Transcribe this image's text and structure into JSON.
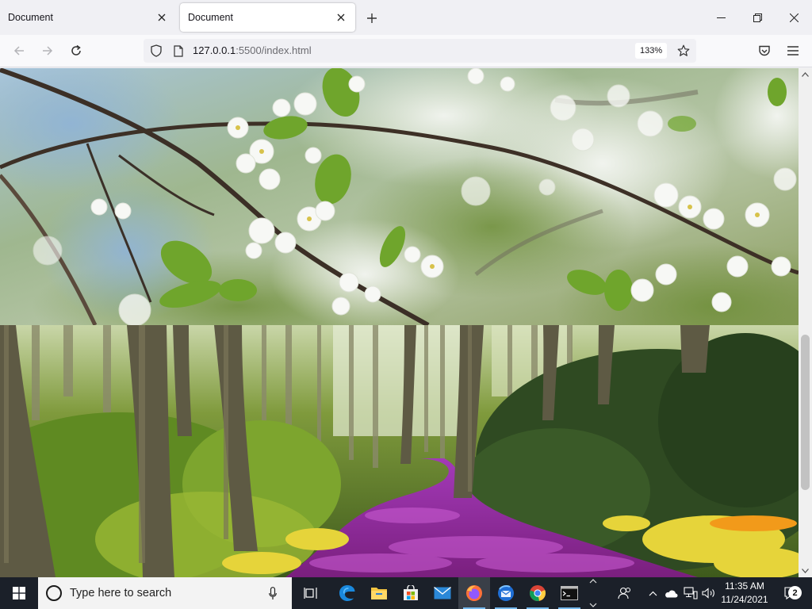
{
  "browser": {
    "tabs": [
      {
        "title": "Document",
        "active": false
      },
      {
        "title": "Document",
        "active": true
      }
    ],
    "new_tab_icon": "plus-icon",
    "window_controls": [
      "minimize-icon",
      "restore-icon",
      "close-icon"
    ],
    "url_host": "127.0.0.1",
    "url_rest": ":5500/index.html",
    "zoom": "133%",
    "accent": "#0060df"
  },
  "page": {
    "images": [
      {
        "subject": "cherry blossom branches"
      },
      {
        "subject": "forest path with purple tulips"
      }
    ]
  },
  "taskbar": {
    "search_placeholder": "Type here to search",
    "pinned": [
      "task-view-icon",
      "edge-icon",
      "file-explorer-icon",
      "store-icon",
      "mail-icon",
      "firefox-icon",
      "thunderbird-icon",
      "chrome-icon",
      "terminal-icon"
    ],
    "time": "11:35 AM",
    "date": "11/24/2021",
    "notifications": "2"
  }
}
